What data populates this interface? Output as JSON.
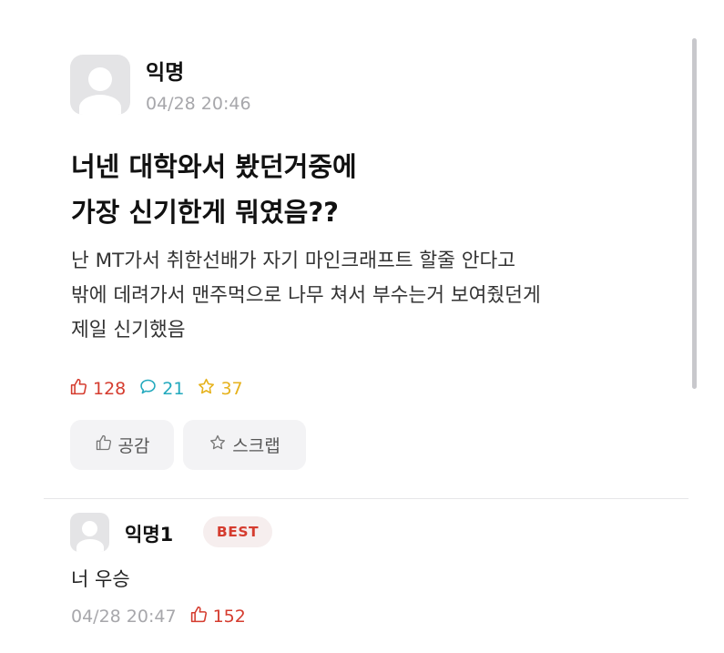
{
  "post": {
    "author": "익명",
    "date": "04/28 20:46",
    "title_line1": "너넨 대학와서 봤던거중에",
    "title_line2": "가장 신기한게 뭐였음??",
    "body_line1": "난 MT가서 취한선배가 자기 마인크래프트 할줄 안다고",
    "body_line2": "밖에 데려가서 맨주먹으로 나무 쳐서 부수는거 보여줬던게",
    "body_line3": "제일 신기했음",
    "likes": "128",
    "comments": "21",
    "scraps": "37"
  },
  "actions": {
    "like_label": "공감",
    "scrap_label": "스크랩"
  },
  "comment": {
    "author": "익명1",
    "badge": "BEST",
    "text": "너 우승",
    "date": "04/28 20:47",
    "likes": "152"
  },
  "colors": {
    "like": "#d53c2f",
    "comment": "#22a9bd",
    "scrap": "#e6b21c",
    "muted": "#a7a7ab"
  },
  "icons": {
    "like": "thumbs-up-icon",
    "comment": "speech-bubble-icon",
    "scrap": "star-icon",
    "avatar": "default-avatar-icon"
  }
}
